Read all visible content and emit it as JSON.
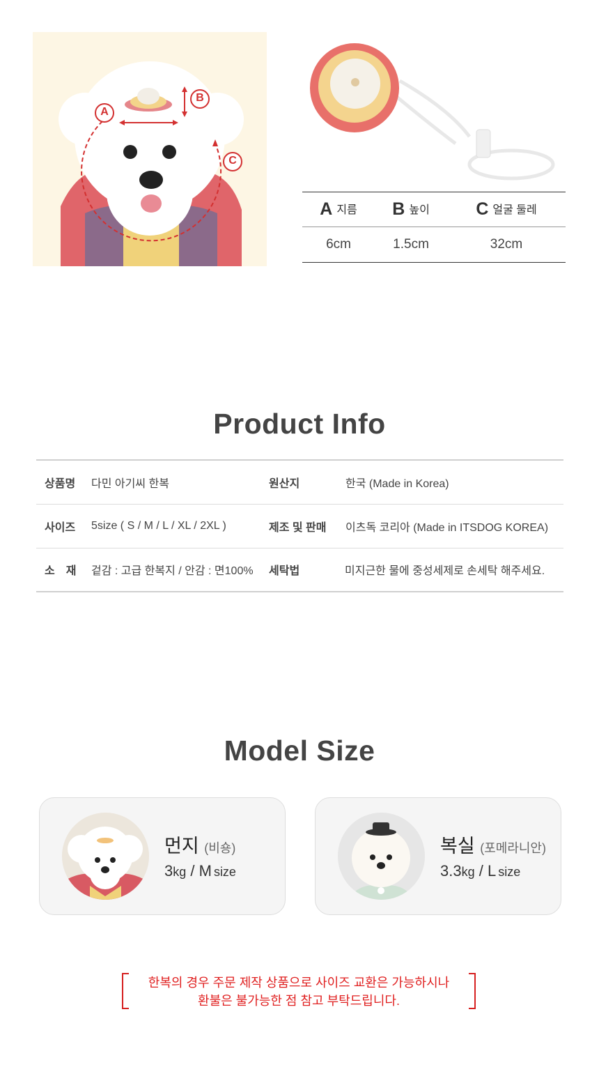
{
  "size_chart": {
    "columns": [
      {
        "letter": "A",
        "label": "지름",
        "value": "6cm"
      },
      {
        "letter": "B",
        "label": "높이",
        "value": "1.5cm"
      },
      {
        "letter": "C",
        "label": "얼굴 둘레",
        "value": "32cm"
      }
    ],
    "photo_labels": {
      "a": "A",
      "b": "B",
      "c": "C"
    }
  },
  "product_info": {
    "title": "Product Info",
    "rows": [
      {
        "k1": "상품명",
        "v1": "다민 아기씨 한복",
        "k2": "원산지",
        "v2": "한국 (Made in Korea)"
      },
      {
        "k1": "사이즈",
        "v1": "5size ( S / M / L / XL / 2XL )",
        "k2": "제조 및 판매",
        "v2": "이츠독 코리아 (Made in ITSDOG KOREA)"
      },
      {
        "k1": "소　재",
        "v1": "겉감 : 고급 한복지 / 안감 : 면100%",
        "k2": "세탁법",
        "v2": "미지근한 물에 중성세제로 손세탁 해주세요."
      }
    ]
  },
  "model_size": {
    "title": "Model Size",
    "models": [
      {
        "name": "먼지",
        "breed": "(비숑)",
        "weight": "3",
        "weight_unit": "kg",
        "sep": " / ",
        "size": "M",
        "size_unit": "size"
      },
      {
        "name": "복실",
        "breed": "(포메라니안)",
        "weight": "3.3",
        "weight_unit": "kg",
        "sep": " / ",
        "size": "L",
        "size_unit": "size"
      }
    ]
  },
  "notice": {
    "line1": "한복의 경우 주문 제작 상품으로 사이즈 교환은 가능하시나",
    "line2": "환불은 불가능한 점 참고 부탁드립니다."
  },
  "colors": {
    "accent_red": "#e02020",
    "dim_line": "#d33030"
  }
}
